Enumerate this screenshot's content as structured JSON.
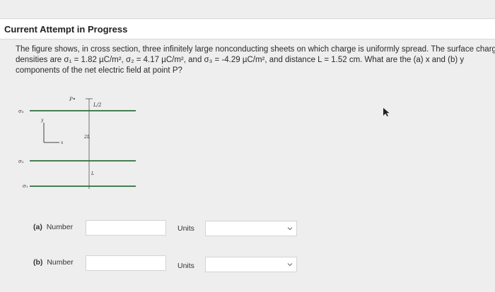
{
  "header": {
    "title": "Current Attempt in Progress"
  },
  "question": {
    "line1": "The figure shows, in cross section, three infinitely large nonconducting sheets on which charge is uniformly spread. The surface charge",
    "line2": "densities are σ₁ = 1.82 µC/m², σ₂ = 4.17 µC/m², and σ₃ = -4.29 µC/m², and distance L = 1.52 cm. What are the (a) x and (b) y",
    "line3": "components of the net electric field at point P?"
  },
  "figure": {
    "point_label": "P•",
    "dist_top": "L/2",
    "dist_mid": "2L",
    "dist_bottom": "L",
    "sheet_top": "σ₃",
    "sheet_mid": "σ₂",
    "sheet_bot": "σ₁",
    "axis_y": "y",
    "axis_x": "x"
  },
  "answers": {
    "a_label": "(a)",
    "a_text": "Number",
    "b_label": "(b)",
    "b_text": "Number",
    "units_label": "Units",
    "a_value": "",
    "b_value": "",
    "a_units": "",
    "b_units": ""
  }
}
